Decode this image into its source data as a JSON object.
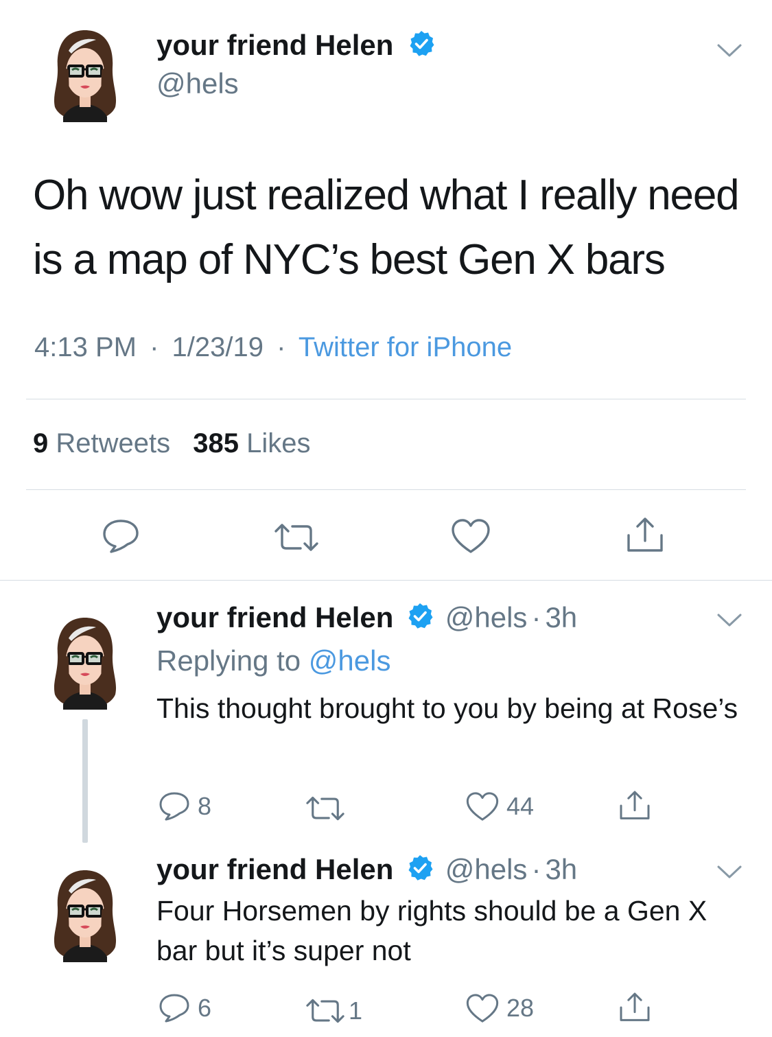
{
  "main_tweet": {
    "name": "your friend Helen",
    "handle": "@hels",
    "text": "Oh wow just realized what I really need is a map of NYC’s best Gen X bars",
    "time": "4:13 PM",
    "date": "1/23/19",
    "sep": "·",
    "source": "Twitter for iPhone",
    "retweets_count": "9",
    "retweets_label": "Retweets",
    "likes_count": "385",
    "likes_label": "Likes"
  },
  "replies": [
    {
      "name": "your friend Helen",
      "handle": "@hels",
      "time": "3h",
      "sep": "·",
      "replying_prefix": "Replying to",
      "replying_handle": "@hels",
      "text": "This thought brought to you by being at Rose’s",
      "reply_count": "8",
      "retweet_count": "",
      "like_count": "44"
    },
    {
      "name": "your friend Helen",
      "handle": "@hels",
      "time": "3h",
      "sep": "·",
      "text": "Four Horsemen by rights should be a Gen X bar but it’s super not",
      "reply_count": "6",
      "retweet_count": "1",
      "like_count": "28"
    }
  ],
  "icons": {
    "verified": "verified-badge-icon",
    "chevron": "chevron-down-icon",
    "reply": "reply-bubble-icon",
    "retweet": "retweet-icon",
    "like": "heart-icon",
    "share": "share-icon"
  },
  "colors": {
    "verified_blue": "#1da1f2",
    "link_blue": "#4b99e0",
    "secondary_text": "#657786",
    "divider": "#d6dde3"
  }
}
